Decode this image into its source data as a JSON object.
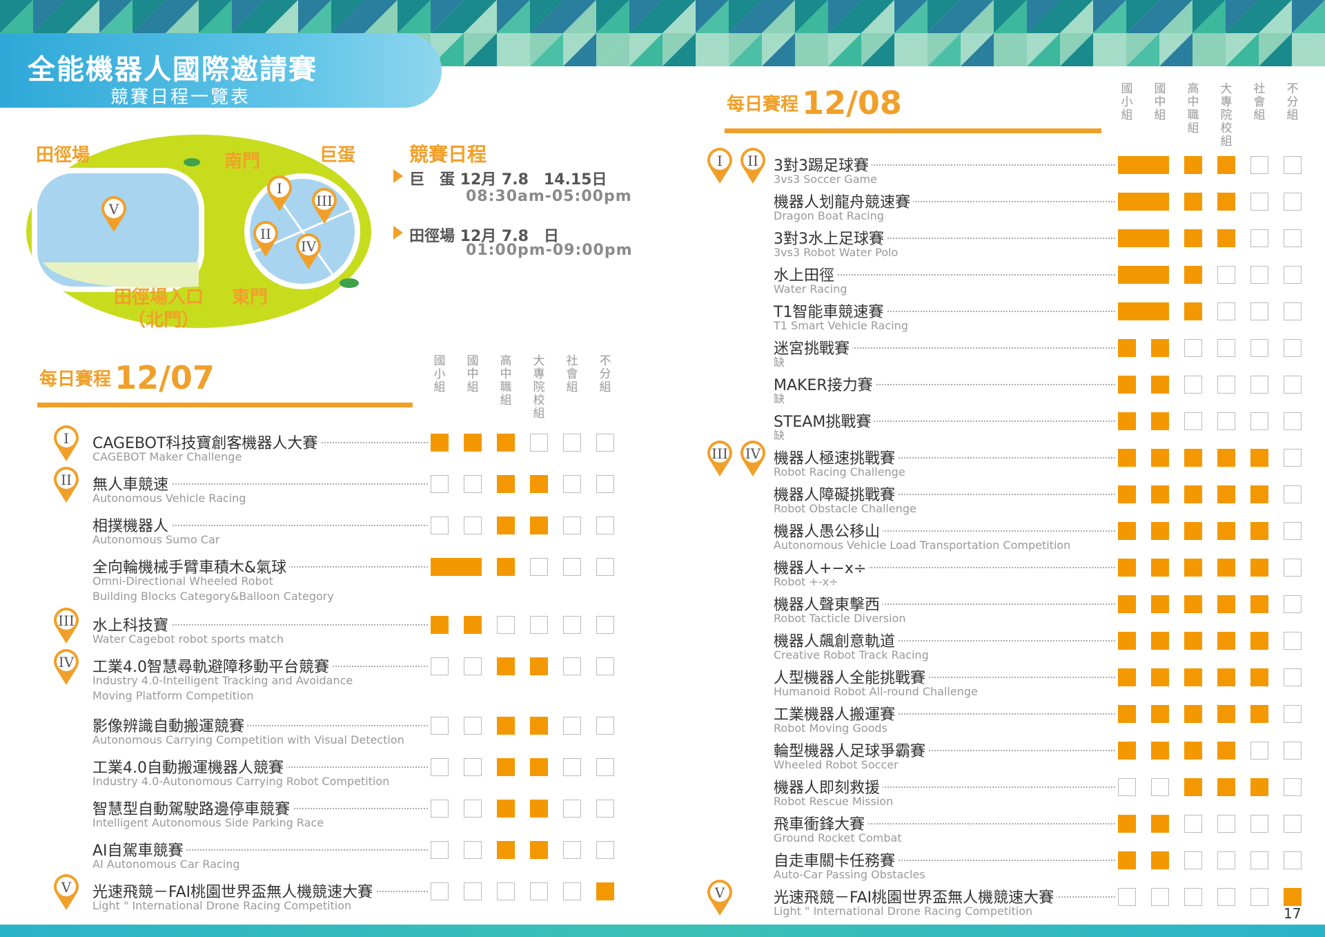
{
  "header": {
    "title": "全能機器人國際邀請賽",
    "subtitle": "競賽日程一覽表"
  },
  "map": {
    "labels": {
      "field": "田徑場",
      "south_gate": "南門",
      "dome": "巨蛋",
      "entrance": "田徑場入口",
      "north_gate": "（北門）",
      "east_gate": "東門"
    },
    "zones": {
      "v": "V",
      "i": "I",
      "iii": "III",
      "ii": "II",
      "iv": "IV"
    }
  },
  "schedule": {
    "heading": "競賽日程",
    "dome": {
      "label": "巨　蛋 12月 7.8　14.15日",
      "time": "08:30am-05:00pm"
    },
    "field": {
      "label": "田徑場 12月 7.8　日",
      "time": "01:00pm-09:00pm"
    }
  },
  "columns": [
    "國小組",
    "國中組",
    "高中職組",
    "大專院校組",
    "社會組",
    "不分組"
  ],
  "day1": {
    "label": "每日賽程",
    "date": "12/07",
    "events": [
      {
        "cn": "CAGEBOT科技寶創客機器人大賽",
        "en": [
          "CAGEBOT Maker Challenge"
        ],
        "marks": [
          1,
          1,
          1,
          0,
          0,
          0
        ],
        "zones": [
          "I"
        ]
      },
      {
        "cn": "無人車競速",
        "en": [
          "Autonomous Vehicle Racing"
        ],
        "marks": [
          0,
          0,
          1,
          1,
          0,
          0
        ],
        "zones": [
          "II"
        ]
      },
      {
        "cn": "相撲機器人",
        "en": [
          "Autonomous Sumo Car"
        ],
        "marks": [
          0,
          0,
          1,
          1,
          0,
          0
        ],
        "zones": []
      },
      {
        "cn": "全向輪機械手臂車積木&氣球",
        "en": [
          "Omni-Directional Wheeled Robot",
          "Building Blocks Category&Balloon Category"
        ],
        "marks": [
          2,
          2,
          1,
          0,
          0,
          0
        ],
        "zones": []
      },
      {
        "cn": "水上科技寶",
        "en": [
          "Water Cagebot robot sports match"
        ],
        "marks": [
          1,
          1,
          0,
          0,
          0,
          0
        ],
        "zones": [
          "III"
        ]
      },
      {
        "cn": "工業4.0智慧尋軌避障移動平台競賽",
        "en": [
          "Industry 4.0-Intelligent Tracking and Avoidance",
          "Moving Platform Competition"
        ],
        "marks": [
          0,
          0,
          1,
          1,
          0,
          0
        ],
        "zones": [
          "IV"
        ]
      },
      {
        "cn": "影像辨識自動搬運競賽",
        "en": [
          "Autonomous Carrying Competition with Visual Detection"
        ],
        "marks": [
          0,
          0,
          1,
          1,
          0,
          0
        ],
        "zones": []
      },
      {
        "cn": "工業4.0自動搬運機器人競賽",
        "en": [
          "Industry 4.0-Autonomous Carrying Robot Competition"
        ],
        "marks": [
          0,
          0,
          1,
          1,
          0,
          0
        ],
        "zones": []
      },
      {
        "cn": "智慧型自動駕駛路邊停車競賽",
        "en": [
          "Intelligent Autonomous Side Parking Race"
        ],
        "marks": [
          0,
          0,
          1,
          1,
          0,
          0
        ],
        "zones": []
      },
      {
        "cn": "AI自駕車競賽",
        "en": [
          "AI Autonomous Car Racing"
        ],
        "marks": [
          0,
          0,
          1,
          1,
          0,
          0
        ],
        "zones": []
      },
      {
        "cn": "光速飛競－FAI桃園世界盃無人機競速大賽",
        "en": [
          "Light \" International Drone Racing Competition"
        ],
        "marks": [
          0,
          0,
          0,
          0,
          0,
          1
        ],
        "zones": [
          "V"
        ]
      }
    ]
  },
  "day2": {
    "label": "每日賽程",
    "date": "12/08",
    "events": [
      {
        "cn": "3對3踢足球賽",
        "en": [
          "3vs3 Soccer Game"
        ],
        "marks": [
          2,
          2,
          1,
          1,
          0,
          0
        ],
        "zones": [
          "I",
          "II"
        ]
      },
      {
        "cn": "機器人划龍舟競速賽",
        "en": [
          "Dragon Boat Racing"
        ],
        "marks": [
          2,
          2,
          1,
          1,
          0,
          0
        ],
        "zones": []
      },
      {
        "cn": "3對3水上足球賽",
        "en": [
          "3vs3 Robot Water Polo"
        ],
        "marks": [
          2,
          2,
          1,
          1,
          0,
          0
        ],
        "zones": []
      },
      {
        "cn": "水上田徑",
        "en": [
          "Water Racing"
        ],
        "marks": [
          2,
          2,
          1,
          0,
          0,
          0
        ],
        "zones": []
      },
      {
        "cn": "T1智能車競速賽",
        "en": [
          "T1 Smart Vehicle Racing"
        ],
        "marks": [
          2,
          2,
          1,
          0,
          0,
          0
        ],
        "zones": []
      },
      {
        "cn": "迷宮挑戰賽",
        "en": [
          "缺"
        ],
        "marks": [
          1,
          1,
          0,
          0,
          0,
          0
        ],
        "zones": []
      },
      {
        "cn": "MAKER接力賽",
        "en": [
          "缺"
        ],
        "marks": [
          1,
          1,
          0,
          0,
          0,
          0
        ],
        "zones": []
      },
      {
        "cn": "STEAM挑戰賽",
        "en": [
          "缺"
        ],
        "marks": [
          1,
          1,
          0,
          0,
          0,
          0
        ],
        "zones": []
      },
      {
        "cn": "機器人極速挑戰賽",
        "en": [
          "Robot Racing Challenge"
        ],
        "marks": [
          1,
          1,
          1,
          1,
          1,
          0
        ],
        "zones": [
          "III",
          "IV"
        ]
      },
      {
        "cn": "機器人障礙挑戰賽",
        "en": [
          "Robot Obstacle Challenge"
        ],
        "marks": [
          1,
          1,
          1,
          1,
          1,
          0
        ],
        "zones": []
      },
      {
        "cn": "機器人愚公移山",
        "en": [
          "Autonomous Vehicle Load Transportation Competition"
        ],
        "marks": [
          1,
          1,
          1,
          1,
          1,
          0
        ],
        "zones": []
      },
      {
        "cn": "機器人+−x÷",
        "en": [
          "Robot +-x÷"
        ],
        "marks": [
          1,
          1,
          1,
          1,
          1,
          0
        ],
        "zones": []
      },
      {
        "cn": "機器人聲東擊西",
        "en": [
          "Robot Tacticle Diversion"
        ],
        "marks": [
          1,
          1,
          1,
          1,
          1,
          0
        ],
        "zones": []
      },
      {
        "cn": "機器人飆創意軌道",
        "en": [
          "Creative Robot Track Racing"
        ],
        "marks": [
          1,
          1,
          1,
          1,
          1,
          0
        ],
        "zones": []
      },
      {
        "cn": "人型機器人全能挑戰賽",
        "en": [
          "Humanoid Robot All-round Challenge"
        ],
        "marks": [
          1,
          1,
          1,
          1,
          1,
          0
        ],
        "zones": []
      },
      {
        "cn": "工業機器人搬運賽",
        "en": [
          "Robot Moving Goods"
        ],
        "marks": [
          1,
          1,
          1,
          1,
          1,
          0
        ],
        "zones": []
      },
      {
        "cn": "輪型機器人足球爭霸賽",
        "en": [
          "Wheeled Robot Soccer"
        ],
        "marks": [
          1,
          1,
          1,
          1,
          0,
          0
        ],
        "zones": []
      },
      {
        "cn": "機器人即刻救援",
        "en": [
          "Robot Rescue Mission"
        ],
        "marks": [
          0,
          0,
          1,
          1,
          1,
          0
        ],
        "zones": []
      },
      {
        "cn": "飛車衝鋒大賽",
        "en": [
          "Ground Rocket Combat"
        ],
        "marks": [
          1,
          1,
          0,
          0,
          0,
          0
        ],
        "zones": []
      },
      {
        "cn": "自走車關卡任務賽",
        "en": [
          "Auto-Car Passing Obstacles"
        ],
        "marks": [
          1,
          1,
          0,
          0,
          0,
          0
        ],
        "zones": []
      },
      {
        "cn": "光速飛競－FAI桃園世界盃無人機競速大賽",
        "en": [
          "Light \" International Drone Racing Competition"
        ],
        "marks": [
          0,
          0,
          0,
          0,
          0,
          1
        ],
        "zones": [
          "V"
        ]
      }
    ]
  },
  "page_number": "17",
  "colors": {
    "accent": "#f39800",
    "blue": "#2ea8d8",
    "lime": "#c8dc1e",
    "teal": "#2ab4c9"
  }
}
